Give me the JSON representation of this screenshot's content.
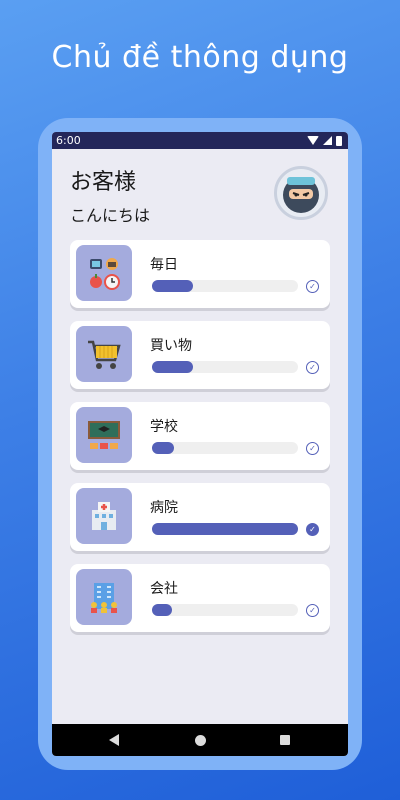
{
  "headline": "Chủ đề thông dụng",
  "status": {
    "time": "6:00"
  },
  "greeting": {
    "title": "お客様",
    "subtitle": "こんにちは"
  },
  "topics": [
    {
      "label": "毎日",
      "progress": 0.28,
      "done": false,
      "icon": "daily-items-icon"
    },
    {
      "label": "買い物",
      "progress": 0.28,
      "done": false,
      "icon": "shopping-cart-icon"
    },
    {
      "label": "学校",
      "progress": 0.15,
      "done": false,
      "icon": "classroom-icon"
    },
    {
      "label": "病院",
      "progress": 1.0,
      "done": true,
      "icon": "hospital-icon"
    },
    {
      "label": "会社",
      "progress": 0.14,
      "done": false,
      "icon": "office-building-icon"
    }
  ],
  "colors": {
    "accent": "#5460b8",
    "thumb_bg": "#a4abdd",
    "status_bar": "#23265a"
  }
}
